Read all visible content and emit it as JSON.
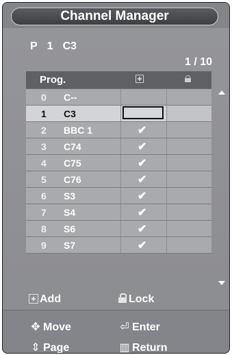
{
  "title": "Channel Manager",
  "info": {
    "prog_label": "P",
    "prog_num": "1",
    "channel": "C3"
  },
  "page_indicator": "1 / 10",
  "table": {
    "header": {
      "prog": "Prog."
    },
    "rows": [
      {
        "num": "0",
        "name": "C--",
        "added": false
      },
      {
        "num": "1",
        "name": "C3",
        "added": false,
        "selected": true
      },
      {
        "num": "2",
        "name": "BBC 1",
        "added": true
      },
      {
        "num": "3",
        "name": "C74",
        "added": true
      },
      {
        "num": "4",
        "name": "C75",
        "added": true
      },
      {
        "num": "5",
        "name": "C76",
        "added": true
      },
      {
        "num": "6",
        "name": "S3",
        "added": true
      },
      {
        "num": "7",
        "name": "S4",
        "added": true
      },
      {
        "num": "8",
        "name": "S6",
        "added": true
      },
      {
        "num": "9",
        "name": "S7",
        "added": true
      }
    ]
  },
  "legend": {
    "add": "Add",
    "lock": "Lock"
  },
  "footer": {
    "move": "Move",
    "enter": "Enter",
    "page": "Page",
    "return": "Return"
  },
  "icons": {
    "check": "✔"
  }
}
